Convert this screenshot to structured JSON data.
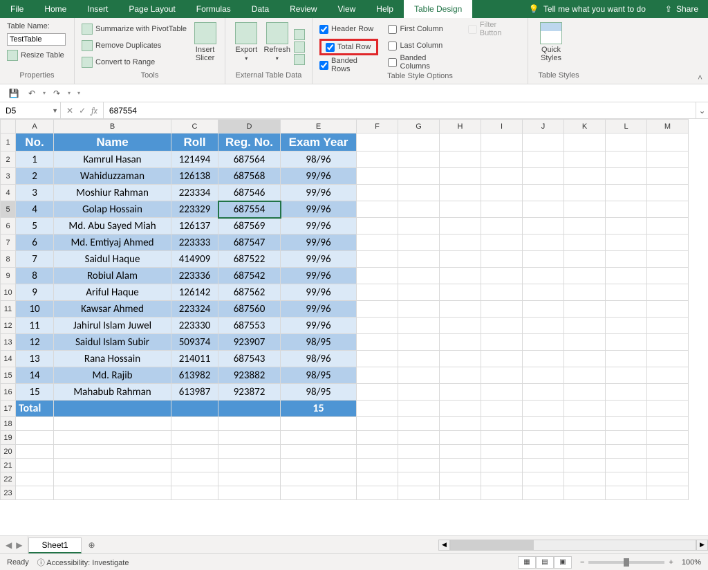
{
  "menu": {
    "items": [
      "File",
      "Home",
      "Insert",
      "Page Layout",
      "Formulas",
      "Data",
      "Review",
      "View",
      "Help",
      "Table Design"
    ],
    "active_index": 9,
    "tell_me": "Tell me what you want to do",
    "share": "Share"
  },
  "ribbon": {
    "properties": {
      "label": "Properties",
      "table_name_label": "Table Name:",
      "table_name_value": "TestTable",
      "resize_table": "Resize Table"
    },
    "tools": {
      "label": "Tools",
      "summarize": "Summarize with PivotTable",
      "remove_dupes": "Remove Duplicates",
      "convert": "Convert to Range",
      "insert_slicer": "Insert\nSlicer"
    },
    "external": {
      "label": "External Table Data",
      "export": "Export",
      "refresh": "Refresh"
    },
    "style_options": {
      "label": "Table Style Options",
      "header_row": {
        "label": "Header Row",
        "checked": true
      },
      "total_row": {
        "label": "Total Row",
        "checked": true
      },
      "banded_rows": {
        "label": "Banded Rows",
        "checked": true
      },
      "first_column": {
        "label": "First Column",
        "checked": false
      },
      "last_column": {
        "label": "Last Column",
        "checked": false
      },
      "banded_columns": {
        "label": "Banded Columns",
        "checked": false
      },
      "filter_button": {
        "label": "Filter Button",
        "checked": false
      }
    },
    "table_styles": {
      "label": "Table Styles",
      "quick_styles": "Quick\nStyles"
    }
  },
  "formula_bar": {
    "name_box": "D5",
    "formula": "687554"
  },
  "grid": {
    "col_headers": [
      "A",
      "B",
      "C",
      "D",
      "E",
      "F",
      "G",
      "H",
      "I",
      "J",
      "K",
      "L",
      "M"
    ],
    "active_col_index": 3,
    "row_count_visible": 23,
    "active_row": 5,
    "table": {
      "headers": [
        "No.",
        "Name",
        "Roll",
        "Reg. No.",
        "Exam Year"
      ],
      "rows": [
        [
          "1",
          "Kamrul Hasan",
          "121494",
          "687564",
          "98/96"
        ],
        [
          "2",
          "Wahiduzzaman",
          "126138",
          "687568",
          "99/96"
        ],
        [
          "3",
          "Moshiur Rahman",
          "223334",
          "687546",
          "99/96"
        ],
        [
          "4",
          "Golap Hossain",
          "223329",
          "687554",
          "99/96"
        ],
        [
          "5",
          "Md. Abu Sayed Miah",
          "126137",
          "687569",
          "99/96"
        ],
        [
          "6",
          "Md. Emtiyaj Ahmed",
          "223333",
          "687547",
          "99/96"
        ],
        [
          "7",
          "Saidul Haque",
          "414909",
          "687522",
          "99/96"
        ],
        [
          "8",
          "Robiul Alam",
          "223336",
          "687542",
          "99/96"
        ],
        [
          "9",
          "Ariful Haque",
          "126142",
          "687562",
          "99/96"
        ],
        [
          "10",
          "Kawsar Ahmed",
          "223324",
          "687560",
          "99/96"
        ],
        [
          "11",
          "Jahirul Islam Juwel",
          "223330",
          "687553",
          "99/96"
        ],
        [
          "12",
          "Saidul Islam Subir",
          "509374",
          "923907",
          "98/95"
        ],
        [
          "13",
          "Rana Hossain",
          "214011",
          "687543",
          "98/96"
        ],
        [
          "14",
          "Md. Rajib",
          "613982",
          "923882",
          "98/95"
        ],
        [
          "15",
          "Mahabub Rahman",
          "613987",
          "923872",
          "98/95"
        ]
      ],
      "total_row": {
        "label": "Total",
        "count_col_index": 4,
        "count": "15"
      }
    }
  },
  "sheets": {
    "active": "Sheet1"
  },
  "status": {
    "ready": "Ready",
    "accessibility": "Accessibility: Investigate",
    "zoom": "100%"
  }
}
